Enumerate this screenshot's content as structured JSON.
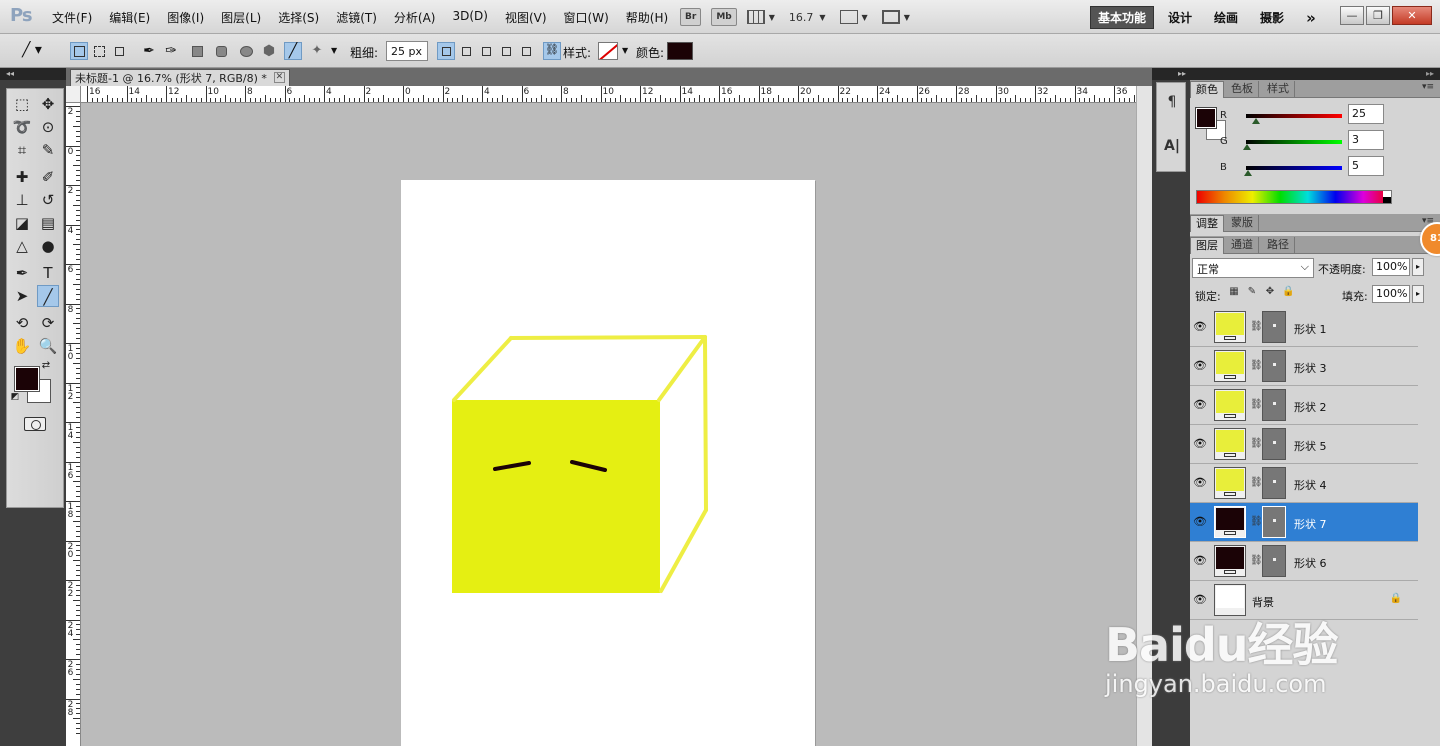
{
  "app": {
    "logo": "Ps"
  },
  "menu": [
    "文件(F)",
    "编辑(E)",
    "图像(I)",
    "图层(L)",
    "选择(S)",
    "滤镜(T)",
    "分析(A)",
    "3D(D)",
    "视图(V)",
    "窗口(W)",
    "帮助(H)"
  ],
  "menubar_extras": {
    "bridge_label": "Br",
    "minibridge_label": "Mb",
    "zoom": "16.7"
  },
  "workspaces": {
    "active": "基本功能",
    "items": [
      "设计",
      "绘画",
      "摄影"
    ],
    "more": "»"
  },
  "window_buttons": {
    "minimize": "—",
    "restore": "❐",
    "close": "✕"
  },
  "options_bar": {
    "weight_label": "粗细:",
    "weight_value": "25 px",
    "style_label": "样式:",
    "color_label": "颜色:",
    "color_hex": "#1b0306"
  },
  "document": {
    "tab_title": "未标题-1 @ 16.7% (形状 7, RGB/8) *",
    "close": "✕"
  },
  "ruler_h_labels": [
    "16",
    "14",
    "12",
    "10",
    "8",
    "6",
    "4",
    "2",
    "0",
    "2",
    "4",
    "6",
    "8",
    "10",
    "12",
    "14",
    "16",
    "18",
    "20",
    "22",
    "24",
    "26",
    "28",
    "30",
    "32",
    "34",
    "36"
  ],
  "ruler_v_labels": [
    "2",
    "0",
    "2",
    "4",
    "6",
    "8",
    "1 0",
    "1 2",
    "1 4",
    "1 6",
    "1 8",
    "2 0",
    "2 2",
    "2 4",
    "2 6",
    "2 8"
  ],
  "canvas": {
    "cube_face_color": "#e5ef12",
    "cube_line_color": "#eeee44",
    "eye_color": "#1b0306"
  },
  "toolbox": {
    "tools": [
      {
        "name": "marquee-tool",
        "glyph": "⬚"
      },
      {
        "name": "move-tool",
        "glyph": "✥"
      },
      {
        "name": "lasso-tool",
        "glyph": "➰"
      },
      {
        "name": "quick-select-tool",
        "glyph": "⊙"
      },
      {
        "name": "crop-tool",
        "glyph": "⌗"
      },
      {
        "name": "eyedropper-tool",
        "glyph": "✎"
      },
      {
        "name": "healing-brush-tool",
        "glyph": "✚"
      },
      {
        "name": "brush-tool",
        "glyph": "✐"
      },
      {
        "name": "clone-stamp-tool",
        "glyph": "⊥"
      },
      {
        "name": "history-brush-tool",
        "glyph": "↺"
      },
      {
        "name": "eraser-tool",
        "glyph": "◪"
      },
      {
        "name": "gradient-tool",
        "glyph": "▤"
      },
      {
        "name": "blur-tool",
        "glyph": "△"
      },
      {
        "name": "dodge-tool",
        "glyph": "●"
      },
      {
        "name": "pen-tool",
        "glyph": "✒"
      },
      {
        "name": "type-tool",
        "glyph": "T"
      },
      {
        "name": "path-select-tool",
        "glyph": "➤"
      },
      {
        "name": "line-tool",
        "glyph": "╱"
      },
      {
        "name": "3d-rotate-tool",
        "glyph": "⟲"
      },
      {
        "name": "3d-orbit-tool",
        "glyph": "⟳"
      },
      {
        "name": "hand-tool",
        "glyph": "✋"
      },
      {
        "name": "zoom-tool",
        "glyph": "🔍"
      }
    ],
    "active_tool": "line-tool",
    "fg_color": "#1b0306",
    "bg_color": "#ffffff"
  },
  "panels": {
    "color_tabs": [
      "颜色",
      "色板",
      "样式"
    ],
    "rgb": [
      {
        "label": "R",
        "value": "25",
        "pos": 0.1
      },
      {
        "label": "G",
        "value": "3",
        "pos": 0.01
      },
      {
        "label": "B",
        "value": "5",
        "pos": 0.02
      }
    ],
    "adjust_tabs": [
      "调整",
      "蒙版"
    ],
    "layer_tabs": [
      "图层",
      "通道",
      "路径"
    ],
    "blend_mode": "正常",
    "opacity_label": "不透明度:",
    "opacity_value": "100%",
    "lock_label": "锁定:",
    "fill_label": "填充:",
    "fill_value": "100%",
    "layers": [
      {
        "name": "形状 1",
        "color": "#e8ee3a",
        "selected": false,
        "visible": true
      },
      {
        "name": "形状 3",
        "color": "#e8ee3a",
        "selected": false,
        "visible": true
      },
      {
        "name": "形状 2",
        "color": "#e8ee3a",
        "selected": false,
        "visible": true
      },
      {
        "name": "形状 5",
        "color": "#e8ee3a",
        "selected": false,
        "visible": true
      },
      {
        "name": "形状 4",
        "color": "#e8ee3a",
        "selected": false,
        "visible": true
      },
      {
        "name": "形状 7",
        "color": "#1b0306",
        "selected": true,
        "visible": true
      },
      {
        "name": "形状 6",
        "color": "#1b0306",
        "selected": false,
        "visible": true
      },
      {
        "name": "背景",
        "color": "#ffffff",
        "selected": false,
        "visible": true
      }
    ]
  },
  "badge": "81",
  "watermark": {
    "main": "Baidu经验",
    "sub": "jingyan.baidu.com"
  }
}
